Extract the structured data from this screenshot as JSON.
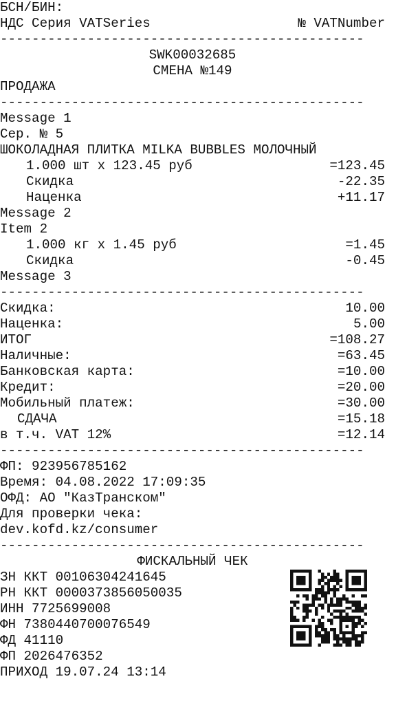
{
  "header": {
    "bin_label": "БСН/БИН:",
    "vat_series": "НДС Серия VATSeries",
    "vat_number": "№ VATNumber",
    "code": "SWK00032685",
    "shift": "СМЕНА №149",
    "operation": "ПРОДАЖА"
  },
  "separator": "----------------------------------------------",
  "items": {
    "msg1": "Message 1",
    "ser": "Сер. № 5",
    "item1_name": "ШОКОЛАДНАЯ ПЛИТКА MILKA BUBBLES МОЛОЧНЫЙ",
    "item1_qty": "1.000 шт x 123.45 руб",
    "item1_sum": "=123.45",
    "item1_disc_label": "Скидка",
    "item1_disc_value": "-22.35",
    "item1_markup_label": "Наценка",
    "item1_markup_value": "+11.17",
    "msg2": "Message 2",
    "item2_name": "Item 2",
    "item2_qty": "1.000 кг x 1.45 руб",
    "item2_sum": "=1.45",
    "item2_disc_label": "Скидка",
    "item2_disc_value": "-0.45",
    "msg3": "Message 3"
  },
  "totals": [
    {
      "label": "Скидка:",
      "value": "10.00",
      "indent": false
    },
    {
      "label": "Наценка:",
      "value": "5.00",
      "indent": false
    },
    {
      "label": "ИТОГ",
      "value": "=108.27",
      "indent": false
    },
    {
      "label": "Наличные:",
      "value": "=63.45",
      "indent": false
    },
    {
      "label": "Банковская карта:",
      "value": "=10.00",
      "indent": false
    },
    {
      "label": "Кредит:",
      "value": "=20.00",
      "indent": false
    },
    {
      "label": "Мобильный платеж:",
      "value": "=30.00",
      "indent": false
    },
    {
      "label": "СДАЧА",
      "value": "=15.18",
      "indent": true
    },
    {
      "label": "в т.ч. VAT 12%",
      "value": "=12.14",
      "indent": false
    }
  ],
  "ofd": {
    "fp": "ФП: 923956785162",
    "time": "Время: 04.08.2022 17:09:35",
    "ofd": "ОФД: АО \"КазТранском\"",
    "check_label": "Для проверки чека:",
    "url": "dev.kofd.kz/consumer"
  },
  "fiscal": {
    "title": "ФИСКАЛЬНЫЙ ЧЕК",
    "zn": "ЗН ККТ 00106304241645",
    "rn": "РН ККТ 0000373856050035",
    "inn": "ИНН 7725699008",
    "fn": "ФН 7380440700076549",
    "fd": "ФД 41110",
    "fp": "ФП 2026476352",
    "income": "ПРИХОД 19.07.24 13:14",
    "qr_icon": "qr-code-icon"
  }
}
